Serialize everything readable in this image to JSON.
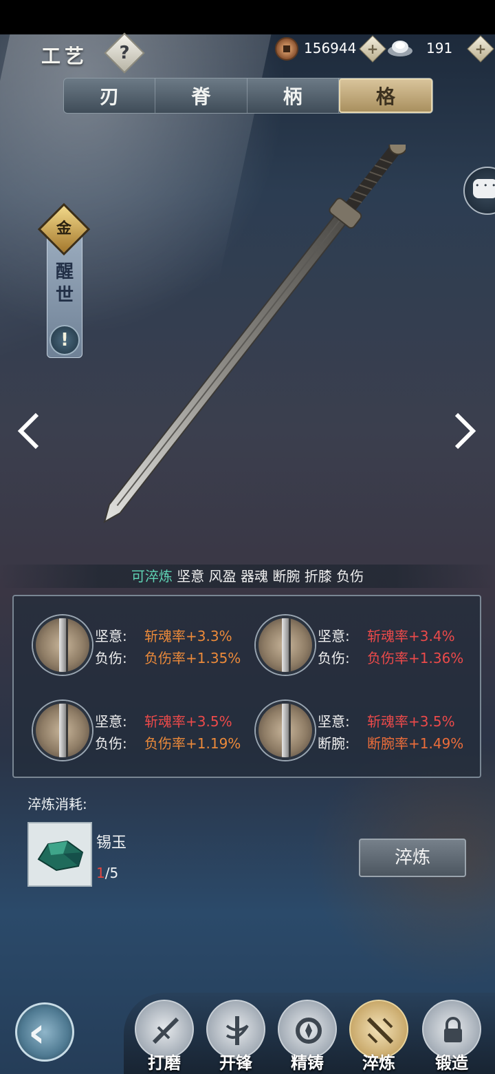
{
  "header": {
    "title": "工艺",
    "help_label": "?",
    "currencies": [
      {
        "name": "copper-coin",
        "value": "156944"
      },
      {
        "name": "silver-ingot",
        "value": "191"
      }
    ],
    "plus_label": "+"
  },
  "tabs": [
    {
      "label": "刃",
      "active": false
    },
    {
      "label": "脊",
      "active": false
    },
    {
      "label": "柄",
      "active": false
    },
    {
      "label": "格",
      "active": true
    }
  ],
  "rank": {
    "badge": "金",
    "name": "醒世",
    "info_label": "!"
  },
  "traits": {
    "highlight": "可淬炼",
    "rest": " 坚意 风盈 器魂 断腕 折膝 负伤"
  },
  "options": [
    {
      "line1_key": "坚意:",
      "line1_val": "斩魂率+3.3%",
      "line2_key": "负伤:",
      "line2_val": "负伤率+1.35%"
    },
    {
      "line1_key": "坚意:",
      "line1_val": "斩魂率+3.4%",
      "line2_key": "负伤:",
      "line2_val": "负伤率+1.36%"
    },
    {
      "line1_key": "坚意:",
      "line1_val": "斩魂率+3.5%",
      "line2_key": "负伤:",
      "line2_val": "负伤率+1.19%"
    },
    {
      "line1_key": "坚意:",
      "line1_val": "斩魂率+3.5%",
      "line2_key": "断腕:",
      "line2_val": "断腕率+1.49%"
    }
  ],
  "cost": {
    "label": "淬炼消耗:",
    "material_name": "锡玉",
    "have": "1",
    "need": "/5"
  },
  "refine_button": "淬炼",
  "nav": [
    {
      "label": "打磨",
      "icon": "grind-icon",
      "active": false
    },
    {
      "label": "开锋",
      "icon": "sharpen-icon",
      "active": false
    },
    {
      "label": "精铸",
      "icon": "cast-icon",
      "active": false
    },
    {
      "label": "淬炼",
      "icon": "temper-icon",
      "active": true
    },
    {
      "label": "锻造",
      "icon": "forge-icon",
      "active": false
    }
  ],
  "colors": {
    "accent_gold": "#c9a96b",
    "highlight_green": "#5fd3b4",
    "value_orange": "#ec8a3a",
    "value_red": "#ec4a4a"
  }
}
